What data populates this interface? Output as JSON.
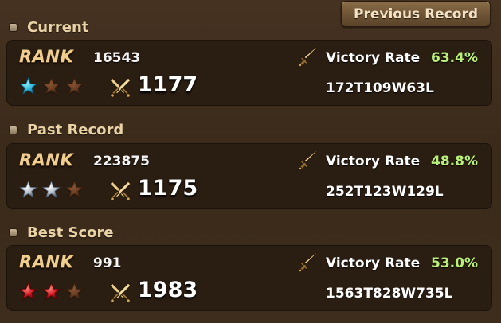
{
  "header": {
    "previous_record_button": "Previous Record"
  },
  "sections": [
    {
      "title": "Current",
      "rank_label": "RANK",
      "rank": "16543",
      "stars": [
        "blue",
        "empty",
        "empty"
      ],
      "score": "1177",
      "victory_rate_label": "Victory Rate",
      "victory_rate": "63.4%",
      "tally": "172T109W63L"
    },
    {
      "title": "Past Record",
      "rank_label": "RANK",
      "rank": "223875",
      "stars": [
        "silver",
        "silver",
        "empty"
      ],
      "score": "1175",
      "victory_rate_label": "Victory Rate",
      "victory_rate": "48.8%",
      "tally": "252T123W129L"
    },
    {
      "title": "Best Score",
      "rank_label": "RANK",
      "rank": "991",
      "stars": [
        "red",
        "red",
        "empty"
      ],
      "score": "1983",
      "victory_rate_label": "Victory Rate",
      "victory_rate": "53.0%",
      "tally": "1563T828W735L"
    }
  ],
  "icons": {
    "section_bullet": "bullet-icon",
    "star": "star-icon",
    "score": "crossed-swords-icon",
    "victory_rate": "sword-icon"
  },
  "colors": {
    "accent_gold": "#f0cf8e",
    "victory_rate_green": "#b9f07a",
    "star_blue": "#2fb7d8",
    "star_silver": "#aeb9c6",
    "star_red": "#d01722",
    "star_empty": "#6b3f22"
  }
}
